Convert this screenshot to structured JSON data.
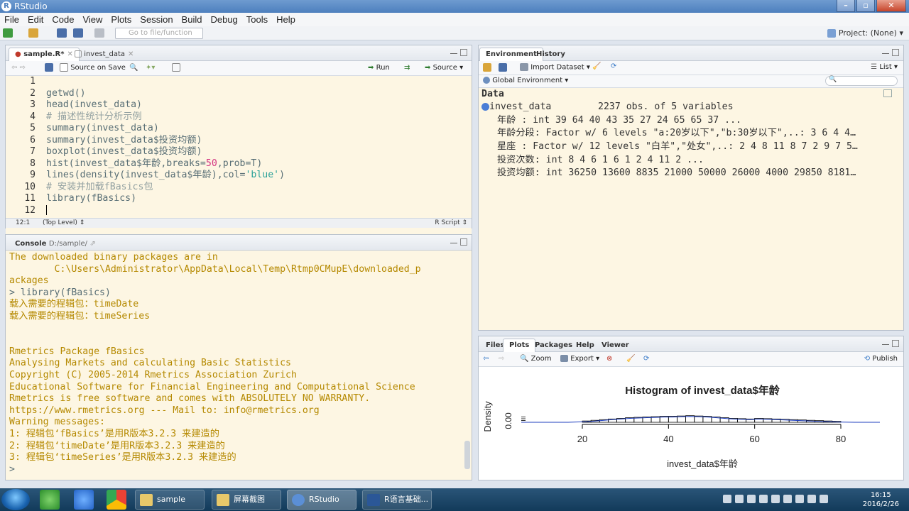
{
  "window": {
    "title": "RStudio"
  },
  "menu": [
    "File",
    "Edit",
    "Code",
    "View",
    "Plots",
    "Session",
    "Build",
    "Debug",
    "Tools",
    "Help"
  ],
  "toolbar": {
    "goto_placeholder": "Go to file/function",
    "project": "Project: (None)"
  },
  "source": {
    "tabs": [
      {
        "label": "sample.R*"
      },
      {
        "label": "invest_data"
      }
    ],
    "source_on_save": "Source on Save",
    "run": "Run",
    "source_btn": "Source",
    "lines": [
      {
        "n": "1",
        "text": ""
      },
      {
        "n": "2",
        "text": "getwd()"
      },
      {
        "n": "3",
        "text": "head(invest_data)"
      },
      {
        "n": "4",
        "text": "# 描述性统计分析示例"
      },
      {
        "n": "5",
        "text": "summary(invest_data)"
      },
      {
        "n": "6",
        "text": "summary(invest_data$投资均额)"
      },
      {
        "n": "7",
        "text": "boxplot(invest_data$投资均额)"
      },
      {
        "n": "8",
        "a": "hist(invest_data$年龄,breaks=",
        "b": "50",
        "c": ",prob=T)"
      },
      {
        "n": "9",
        "a": "lines(density(invest_data$年龄),col=",
        "b": "'blue'",
        "c": ")"
      },
      {
        "n": "10",
        "text": "# 安装并加载fBasics包"
      },
      {
        "n": "11",
        "text": "library(fBasics)"
      },
      {
        "n": "12",
        "text": ""
      }
    ],
    "status": {
      "pos": "12:1",
      "level": "(Top Level) ⇕",
      "type": "R Script ⇕"
    }
  },
  "console": {
    "title": "Console",
    "path": "D:/sample/",
    "lines": [
      "The downloaded binary packages are in",
      "        C:\\Users\\Administrator\\AppData\\Local\\Temp\\Rtmp0CMupE\\downloaded_p",
      "ackages",
      "> library(fBasics)",
      "载入需要的程辑包：timeDate",
      "载入需要的程辑包：timeSeries",
      "",
      "",
      "Rmetrics Package fBasics",
      "Analysing Markets and calculating Basic Statistics",
      "Copyright (C) 2005-2014 Rmetrics Association Zurich",
      "Educational Software for Financial Engineering and Computational Science",
      "Rmetrics is free software and comes with ABSOLUTELY NO WARRANTY.",
      "https://www.rmetrics.org --- Mail to: info@rmetrics.org",
      "Warning messages:",
      "1: 程辑包‘fBasics’是用R版本3.2.3 来建造的",
      "2: 程辑包‘timeDate’是用R版本3.2.3 来建造的",
      "3: 程辑包‘timeSeries’是用R版本3.2.3 来建造的",
      "> "
    ]
  },
  "environment": {
    "tabs": [
      "Environment",
      "History"
    ],
    "import": "Import Dataset ▾",
    "list": "List ▾",
    "scope": "Global Environment ▾",
    "section": "Data",
    "obj_name": "invest_data",
    "obj_desc": "2237 obs. of 5 variables",
    "rows": [
      "年龄 : int 39 64 40 43 35 27 24 65 65 37 ...",
      "年龄分段: Factor w/ 6 levels \"a:20岁以下\",\"b:30岁以下\",..: 3 6 4 4…",
      "星座 : Factor w/ 12 levels \"白羊\",\"处女\",..: 2 4 8 11 8 7 2 9 7 5…",
      "投资次数: int 8 4 6 1 6 1 2 4 11 2 ...",
      "投资均额: int 36250 13600 8835 21000 50000 26000 4000 29850 8181…"
    ]
  },
  "files": {
    "tabs": [
      "Files",
      "Plots",
      "Packages",
      "Help",
      "Viewer"
    ],
    "zoom": "Zoom",
    "export": "Export ▾",
    "publish": "Publish"
  },
  "chart_data": {
    "type": "bar",
    "title": "Histogram of invest_data$年龄",
    "xlabel": "invest_data$年龄",
    "ylabel": "Density",
    "y_ticks": [
      "0.00"
    ],
    "x_ticks": [
      20,
      40,
      60,
      80
    ],
    "xlim": [
      20,
      80
    ],
    "ylim": [
      0,
      0.03
    ],
    "bins_x": [
      20,
      22,
      24,
      26,
      28,
      30,
      32,
      34,
      36,
      38,
      40,
      42,
      44,
      46,
      48,
      50,
      52,
      54,
      56,
      58,
      60,
      62,
      64,
      66,
      68,
      70,
      72,
      74,
      76,
      78
    ],
    "values": [
      0.004,
      0.006,
      0.008,
      0.01,
      0.012,
      0.014,
      0.015,
      0.016,
      0.017,
      0.018,
      0.018,
      0.019,
      0.02,
      0.019,
      0.018,
      0.016,
      0.014,
      0.012,
      0.011,
      0.01,
      0.012,
      0.011,
      0.01,
      0.009,
      0.008,
      0.007,
      0.006,
      0.005,
      0.004,
      0.003
    ],
    "density_color": "#1f3fbf"
  },
  "taskbar": {
    "items": [
      {
        "label": "sample"
      },
      {
        "label": "屏幕截图"
      },
      {
        "label": "RStudio"
      },
      {
        "label": "R语言基础..."
      }
    ],
    "time": "16:15",
    "date": "2016/2/26"
  }
}
